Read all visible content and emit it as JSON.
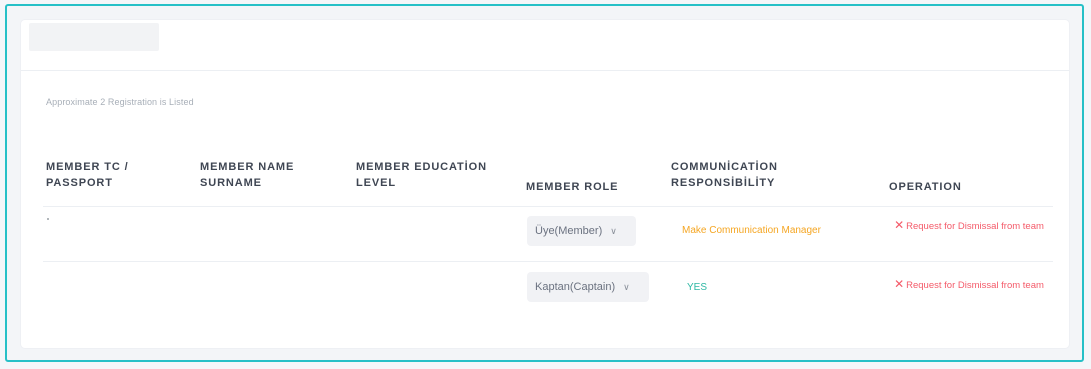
{
  "summary": "Approximate 2 Registration is Listed",
  "columns": {
    "tc": [
      "MEMBER TC /",
      "PASSPORT"
    ],
    "name": [
      "MEMBER NAME",
      "SURNAME"
    ],
    "education": [
      "MEMBER EDUCATİON",
      "LEVEL"
    ],
    "role": "MEMBER ROLE",
    "communication": [
      "COMMUNİCATİON",
      "RESPONSİBİLİTY"
    ],
    "operation": "OPERATION"
  },
  "rows": [
    {
      "role": "Üye(Member)",
      "communication": "Make Communication Manager",
      "operation": "Request for Dismissal from team"
    },
    {
      "role": "Kaptan(Captain)",
      "communication": "YES",
      "operation": "Request for Dismissal from team"
    }
  ],
  "colors": {
    "accent_border": "#26c0c7",
    "communication_link": "#f5a623",
    "communication_yes": "#2fb8a4",
    "dismiss": "#f45b6a"
  },
  "icons": {
    "select": "chevron-down-icon",
    "dismiss": "close-icon"
  }
}
